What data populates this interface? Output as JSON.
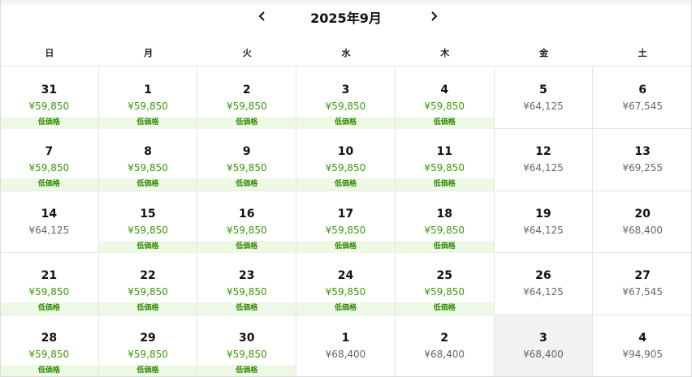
{
  "header": {
    "title": "2025年9月",
    "prev_icon": "chevron-left-icon",
    "next_icon": "chevron-right-icon"
  },
  "weekdays": [
    "日",
    "月",
    "火",
    "水",
    "木",
    "金",
    "土"
  ],
  "colors": {
    "low_price": "#3a9a06",
    "low_badge_bg": "#edf9e4",
    "normal_price": "#666666",
    "selected_bg": "#f2f2f2"
  },
  "weeks": [
    [
      {
        "day": "31",
        "price": "¥59,850",
        "badge": "低価格"
      },
      {
        "day": "1",
        "price": "¥59,850",
        "badge": "低価格"
      },
      {
        "day": "2",
        "price": "¥59,850",
        "badge": "低価格"
      },
      {
        "day": "3",
        "price": "¥59,850",
        "badge": "低価格"
      },
      {
        "day": "4",
        "price": "¥59,850",
        "badge": "低価格"
      },
      {
        "day": "5",
        "price": "¥64,125",
        "badge": null
      },
      {
        "day": "6",
        "price": "¥67,545",
        "badge": null
      }
    ],
    [
      {
        "day": "7",
        "price": "¥59,850",
        "badge": "低価格"
      },
      {
        "day": "8",
        "price": "¥59,850",
        "badge": "低価格"
      },
      {
        "day": "9",
        "price": "¥59,850",
        "badge": "低価格"
      },
      {
        "day": "10",
        "price": "¥59,850",
        "badge": "低価格"
      },
      {
        "day": "11",
        "price": "¥59,850",
        "badge": "低価格"
      },
      {
        "day": "12",
        "price": "¥64,125",
        "badge": null
      },
      {
        "day": "13",
        "price": "¥69,255",
        "badge": null
      }
    ],
    [
      {
        "day": "14",
        "price": "¥64,125",
        "badge": null
      },
      {
        "day": "15",
        "price": "¥59,850",
        "badge": "低価格"
      },
      {
        "day": "16",
        "price": "¥59,850",
        "badge": "低価格"
      },
      {
        "day": "17",
        "price": "¥59,850",
        "badge": "低価格"
      },
      {
        "day": "18",
        "price": "¥59,850",
        "badge": "低価格"
      },
      {
        "day": "19",
        "price": "¥64,125",
        "badge": null
      },
      {
        "day": "20",
        "price": "¥68,400",
        "badge": null
      }
    ],
    [
      {
        "day": "21",
        "price": "¥59,850",
        "badge": "低価格"
      },
      {
        "day": "22",
        "price": "¥59,850",
        "badge": "低価格"
      },
      {
        "day": "23",
        "price": "¥59,850",
        "badge": "低価格"
      },
      {
        "day": "24",
        "price": "¥59,850",
        "badge": "低価格"
      },
      {
        "day": "25",
        "price": "¥59,850",
        "badge": "低価格"
      },
      {
        "day": "26",
        "price": "¥64,125",
        "badge": null
      },
      {
        "day": "27",
        "price": "¥67,545",
        "badge": null
      }
    ],
    [
      {
        "day": "28",
        "price": "¥59,850",
        "badge": "低価格"
      },
      {
        "day": "29",
        "price": "¥59,850",
        "badge": "低価格"
      },
      {
        "day": "30",
        "price": "¥59,850",
        "badge": "低価格"
      },
      {
        "day": "1",
        "price": "¥68,400",
        "badge": null
      },
      {
        "day": "2",
        "price": "¥68,400",
        "badge": null
      },
      {
        "day": "3",
        "price": "¥68,400",
        "badge": null,
        "selected": true
      },
      {
        "day": "4",
        "price": "¥94,905",
        "badge": null
      }
    ]
  ]
}
